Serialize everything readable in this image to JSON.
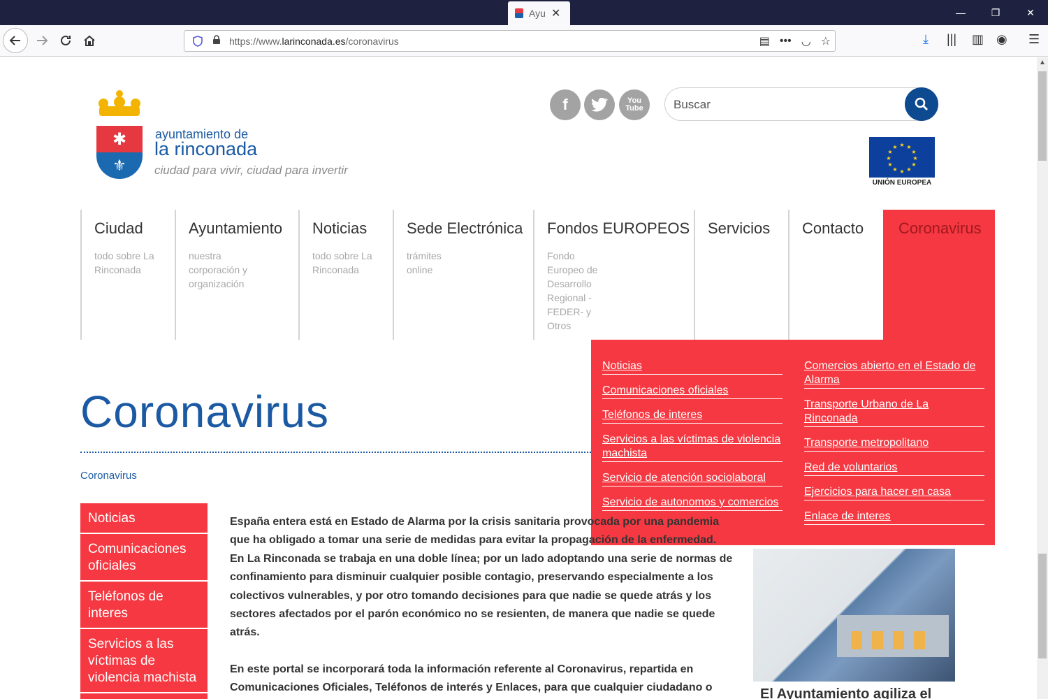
{
  "browser": {
    "tab_title": "Ayu",
    "url_prefix": "https://www.",
    "url_domain": "larinconada.es",
    "url_path": "/coronavirus"
  },
  "header": {
    "logo_line1": "ayuntamiento de",
    "logo_line2": "la rinconada",
    "tagline": "ciudad para vivir, ciudad para invertir",
    "search_placeholder": "Buscar",
    "eu_label": "UNIÓN EUROPEA"
  },
  "nav": [
    {
      "title": "Ciudad",
      "sub": "todo sobre La Rinconada"
    },
    {
      "title": "Ayuntamiento",
      "sub": "nuestra corporación y organización"
    },
    {
      "title": "Noticias",
      "sub": "todo sobre La Rinconada"
    },
    {
      "title": "Sede Electrónica",
      "sub": "trámites online"
    },
    {
      "title": "Fondos EUROPEOS",
      "sub": "Fondo Europeo de Desarrollo Regional -FEDER- y Otros"
    },
    {
      "title": "Servicios",
      "sub": ""
    },
    {
      "title": "Contacto",
      "sub": ""
    },
    {
      "title": "Coronavirus",
      "sub": ""
    }
  ],
  "dropdown": {
    "left": [
      "Noticias",
      "Comunicaciones oficiales",
      "Teléfonos de interes",
      "Servicios a las víctimas de violencia machista",
      "Servicio de atención sociolaboral",
      "Servicio de autonomos y comercios"
    ],
    "right": [
      "Comercios abierto en el Estado de Alarma",
      "Transporte Urbano de La Rinconada",
      "Transporte metropolitano",
      "Red de voluntarios",
      "Ejercicios para hacer en casa",
      "Enlace de interes"
    ]
  },
  "content": {
    "title": "Coronavirus",
    "breadcrumb": "Coronavirus",
    "sidebar": [
      "Noticias",
      "Comunicaciones oficiales",
      "Teléfonos de interes",
      "Servicios a las víctimas de violencia machista"
    ],
    "paragraph1": "España entera está en Estado de Alarma por la crisis sanitaria provocada por una pandemia que ha obligado a tomar una serie de medidas para evitar la propagación de la enfermedad. En La Rinconada se trabaja en una doble línea; por un lado adoptando una serie de normas de confinamiento para disminuir cualquier posible contagio, preservando especialmente a los colectivos vulnerables, y por otro tomando decisiones para que nadie se quede atrás y los sectores afectados por el parón económico no se resienten, de manera que nadie se quede atrás.",
    "paragraph2": "En este portal se incorporará toda la información referente al Coronavirus, repartida en Comunicaciones Oficiales, Teléfonos de interés y Enlaces, para que cualquier ciudadano o",
    "news_title": "El Ayuntamiento agiliza el"
  },
  "colors": {
    "accent_red": "#f53841",
    "brand_blue": "#1b5aa3",
    "search_blue": "#0d4a90"
  }
}
